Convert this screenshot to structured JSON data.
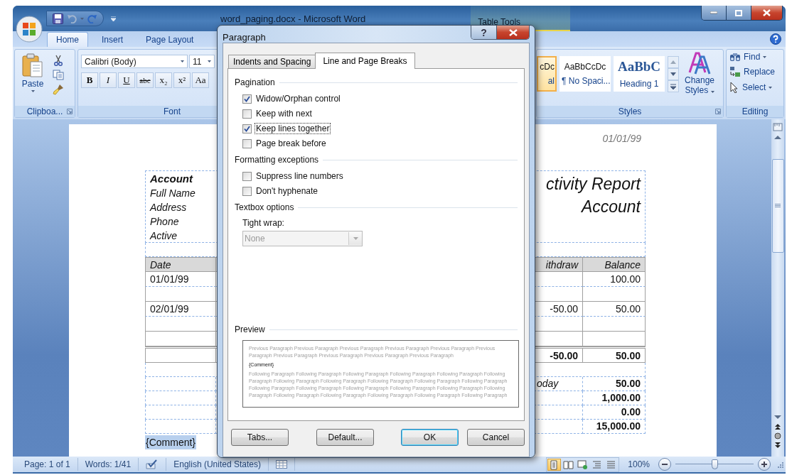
{
  "window": {
    "title": "word_paging.docx - Microsoft Word",
    "contextual_tab": "Table Tools"
  },
  "ribbon_tabs": [
    {
      "label": "Home",
      "selected": true
    },
    {
      "label": "Insert",
      "selected": false
    },
    {
      "label": "Page Layout",
      "selected": false
    }
  ],
  "ribbon": {
    "clipboard": {
      "label": "Clipboa...",
      "paste": "Paste"
    },
    "font": {
      "label": "Font",
      "font_name": "Calibri (Body)",
      "font_size": "11",
      "buttons": [
        {
          "label": "B",
          "kind": "bold"
        },
        {
          "label": "I",
          "kind": "italic"
        },
        {
          "label": "U",
          "kind": "underline"
        },
        {
          "label": "abc",
          "kind": "strike"
        },
        {
          "label": "x₂",
          "kind": "plain"
        },
        {
          "label": "x²",
          "kind": "plain"
        },
        {
          "label": "Aa",
          "kind": "plain"
        }
      ]
    },
    "styles": {
      "label": "Styles",
      "gallery": [
        {
          "sample": "cDc",
          "name": "al",
          "kind": "normal",
          "selected": true
        },
        {
          "sample": "AaBbCcDc",
          "name": "¶ No Spaci...",
          "kind": "normal",
          "selected": false
        },
        {
          "sample": "AaBbC",
          "name": "Heading 1",
          "kind": "heading",
          "selected": false
        }
      ],
      "change_styles": "Change Styles"
    },
    "editing": {
      "label": "Editing",
      "buttons": [
        {
          "label": "Find",
          "kind": "find"
        },
        {
          "label": "Replace",
          "kind": "replace"
        },
        {
          "label": "Select",
          "kind": "select"
        }
      ]
    }
  },
  "document": {
    "header_date": "01/01/99",
    "account": {
      "title": "Account",
      "fields": [
        "Full Name",
        "Address",
        "Phone",
        "Active"
      ]
    },
    "report_title": [
      "ctivity Report",
      "Account"
    ],
    "table": {
      "columns": [
        "Date",
        "ithdraw",
        "Balance"
      ],
      "rows": [
        {
          "kind": "entry",
          "date": "01/01/99",
          "balance": "100.00"
        },
        {
          "kind": "blank"
        },
        {
          "kind": "entry",
          "date": "02/01/99",
          "withdraw": "-50.00",
          "balance": "50.00"
        },
        {
          "kind": "blank"
        },
        {
          "kind": "blank"
        },
        {
          "kind": "total",
          "withdraw": "-50.00",
          "balance": "50.00"
        }
      ]
    },
    "summary": [
      {
        "label": "oday",
        "value": "50.00"
      },
      {
        "value": "1,000.00"
      },
      {
        "value": "0.00"
      },
      {
        "value": "15,000.00"
      }
    ],
    "comment": "{Comment}"
  },
  "status_bar": {
    "page": "Page: 1 of 1",
    "words": "Words: 1/41",
    "language": "English (United States)",
    "views": [
      {
        "kind": "print",
        "selected": true
      },
      {
        "kind": "reading",
        "selected": false
      },
      {
        "kind": "web",
        "selected": false
      },
      {
        "kind": "outline",
        "selected": false
      },
      {
        "kind": "draft",
        "selected": false
      }
    ],
    "zoom": "100%",
    "zoom_slider": {
      "level": 0.5
    }
  },
  "dialog": {
    "title": "Paragraph",
    "help": "?",
    "tabs": [
      {
        "label": "Indents and Spacing",
        "selected": false
      },
      {
        "label": "Line and Page Breaks",
        "selected": true
      }
    ],
    "sections": [
      {
        "title": "Pagination",
        "kind": "checkboxes",
        "options": [
          {
            "label": "Widow/Orphan control",
            "checked": true,
            "focused": false
          },
          {
            "label": "Keep with next",
            "checked": false,
            "focused": false
          },
          {
            "label": "Keep lines together",
            "checked": true,
            "focused": true
          },
          {
            "label": "Page break before",
            "checked": false,
            "focused": false
          }
        ]
      },
      {
        "title": "Formatting exceptions",
        "kind": "checkboxes",
        "options": [
          {
            "label": "Suppress line numbers",
            "checked": false,
            "focused": false
          },
          {
            "label": "Don't hyphenate",
            "checked": false,
            "focused": false
          }
        ]
      },
      {
        "title": "Textbox options",
        "kind": "dropdown",
        "label": "Tight wrap:",
        "value": "None",
        "disabled": true
      }
    ],
    "preview": {
      "title": "Preview",
      "previous": [
        "Previous Paragraph Previous Paragraph Previous Paragraph Previous Paragraph Previous Paragraph Previous",
        "Paragraph Previous Paragraph Previous Paragraph Previous Paragraph Previous Paragraph"
      ],
      "current": "{Comment}",
      "following": [
        "Following Paragraph Following Paragraph Following Paragraph Following Paragraph Following Paragraph Following",
        "Paragraph Following Paragraph Following Paragraph Following Paragraph Following Paragraph Following Paragraph",
        "Following Paragraph Following Paragraph Following Paragraph Following Paragraph Following Paragraph Following",
        "Paragraph Following Paragraph Following Paragraph Following Paragraph Following Paragraph Following Paragraph"
      ]
    },
    "buttons": [
      {
        "label": "Tabs...",
        "default": false
      },
      {
        "label": "Default...",
        "default": false
      },
      {
        "label": "OK",
        "default": true
      },
      {
        "label": "Cancel",
        "default": false
      }
    ]
  }
}
